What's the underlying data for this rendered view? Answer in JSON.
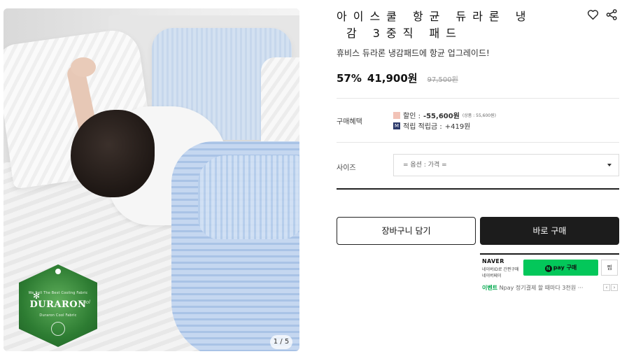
{
  "gallery": {
    "counter": "1 / 5",
    "badge": {
      "brand": "DURARON",
      "brand_sub": "Cool",
      "top_text": "We Sell The Best Cooling Fabric",
      "bottom_text": "Duraron Cool Fabric"
    }
  },
  "product": {
    "title_line1": "아이스쿨 항균 듀라론 냉",
    "title_line2": "감 3중직 패드",
    "subtitle": "휴비스 듀라론 냉감패드에 항균 업그레이드!",
    "discount_rate": "57%",
    "price": "41,900원",
    "original_price": "97,500원"
  },
  "benefits": {
    "label": "구매혜택",
    "discount_label": "할인 :",
    "discount_value": "-55,600원",
    "discount_note": "(상품 : 55,600원)",
    "points_label": "적립 적립금 :",
    "points_value": "+419원",
    "points_icon_text": "M"
  },
  "options": {
    "label": "사이즈",
    "placeholder": "= 옵션 : 가격 ="
  },
  "actions": {
    "cart_label": "장바구니 담기",
    "buy_label": "바로 구매"
  },
  "naverpay": {
    "brand": "NAVER",
    "desc_line1": "네이버ID로 간편구매",
    "desc_line2": "네이버페이",
    "pay_label": "pay 구매",
    "pay_icon": "N",
    "wish_label": "찜",
    "event_tag": "이벤트",
    "event_text": "Npay 정기결제 할 때마다 3천원 ···",
    "prev": "‹",
    "next": "›"
  },
  "colors": {
    "buy_button": "#1c1c1c",
    "naver_green": "#03c75a",
    "discount_swatch": "#f2c3b7",
    "points_swatch": "#2c3a6b"
  },
  "icons": [
    "heart-icon",
    "share-icon",
    "dropdown-caret-icon",
    "naver-pay-icon"
  ]
}
